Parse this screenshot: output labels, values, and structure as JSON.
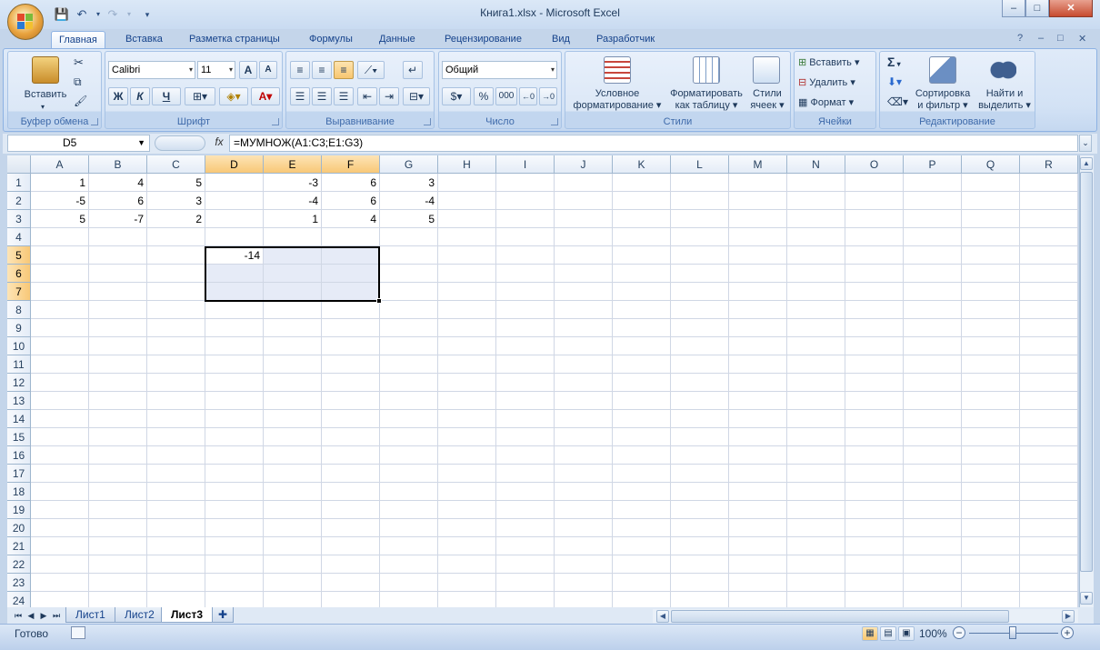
{
  "window": {
    "title": "Книга1.xlsx - Microsoft Excel",
    "minimize": "–",
    "maximize": "□",
    "close": "✕"
  },
  "qat": {
    "more": "▾"
  },
  "tabs": [
    {
      "label": "Главная",
      "active": true
    },
    {
      "label": "Вставка"
    },
    {
      "label": "Разметка страницы"
    },
    {
      "label": "Формулы"
    },
    {
      "label": "Данные"
    },
    {
      "label": "Рецензирование"
    },
    {
      "label": "Вид"
    },
    {
      "label": "Разработчик"
    }
  ],
  "ribbon": {
    "clipboard": {
      "label": "Буфер обмена",
      "paste": "Вставить"
    },
    "font": {
      "label": "Шрифт",
      "font_name": "Calibri",
      "font_size": "11",
      "bold": "Ж",
      "italic": "К",
      "underline": "Ч"
    },
    "alignment": {
      "label": "Выравнивание"
    },
    "number": {
      "label": "Число",
      "format": "Общий",
      "percent": "%",
      "thousands": "000"
    },
    "styles": {
      "label": "Стили",
      "conditional": "Условное\nформатирование",
      "conditional_1": "Условное",
      "conditional_2": "форматирование",
      "format_table_1": "Форматировать",
      "format_table_2": "как таблицу",
      "cell_styles_1": "Стили",
      "cell_styles_2": "ячеек"
    },
    "cells": {
      "label": "Ячейки",
      "insert": "Вставить",
      "delete": "Удалить",
      "format": "Формат"
    },
    "editing": {
      "label": "Редактирование",
      "sigma": "Σ",
      "sort_1": "Сортировка",
      "sort_2": "и фильтр",
      "find_1": "Найти и",
      "find_2": "выделить"
    }
  },
  "formula_bar": {
    "name_box": "D5",
    "fx": "fx",
    "formula": "=МУМНОЖ(A1:C3;E1:G3)"
  },
  "columns": [
    "A",
    "B",
    "C",
    "D",
    "E",
    "F",
    "G",
    "H",
    "I",
    "J",
    "K",
    "L",
    "M",
    "N",
    "O",
    "P",
    "Q",
    "R"
  ],
  "rows": [
    "1",
    "2",
    "3",
    "4",
    "5",
    "6",
    "7",
    "8",
    "9",
    "10",
    "11",
    "12",
    "13",
    "14",
    "15",
    "16",
    "17",
    "18",
    "19",
    "20",
    "21",
    "22",
    "23",
    "24"
  ],
  "cells": {
    "A1": "1",
    "B1": "4",
    "C1": "5",
    "E1": "-3",
    "F1": "6",
    "G1": "3",
    "A2": "-5",
    "B2": "6",
    "C2": "3",
    "E2": "-4",
    "F2": "6",
    "G2": "-4",
    "A3": "5",
    "B3": "-7",
    "C3": "2",
    "E3": "1",
    "F3": "4",
    "G3": "5",
    "D5": "-14"
  },
  "sheets": [
    {
      "label": "Лист1"
    },
    {
      "label": "Лист2"
    },
    {
      "label": "Лист3",
      "active": true
    }
  ],
  "status": {
    "ready": "Готово",
    "zoom": "100%"
  }
}
